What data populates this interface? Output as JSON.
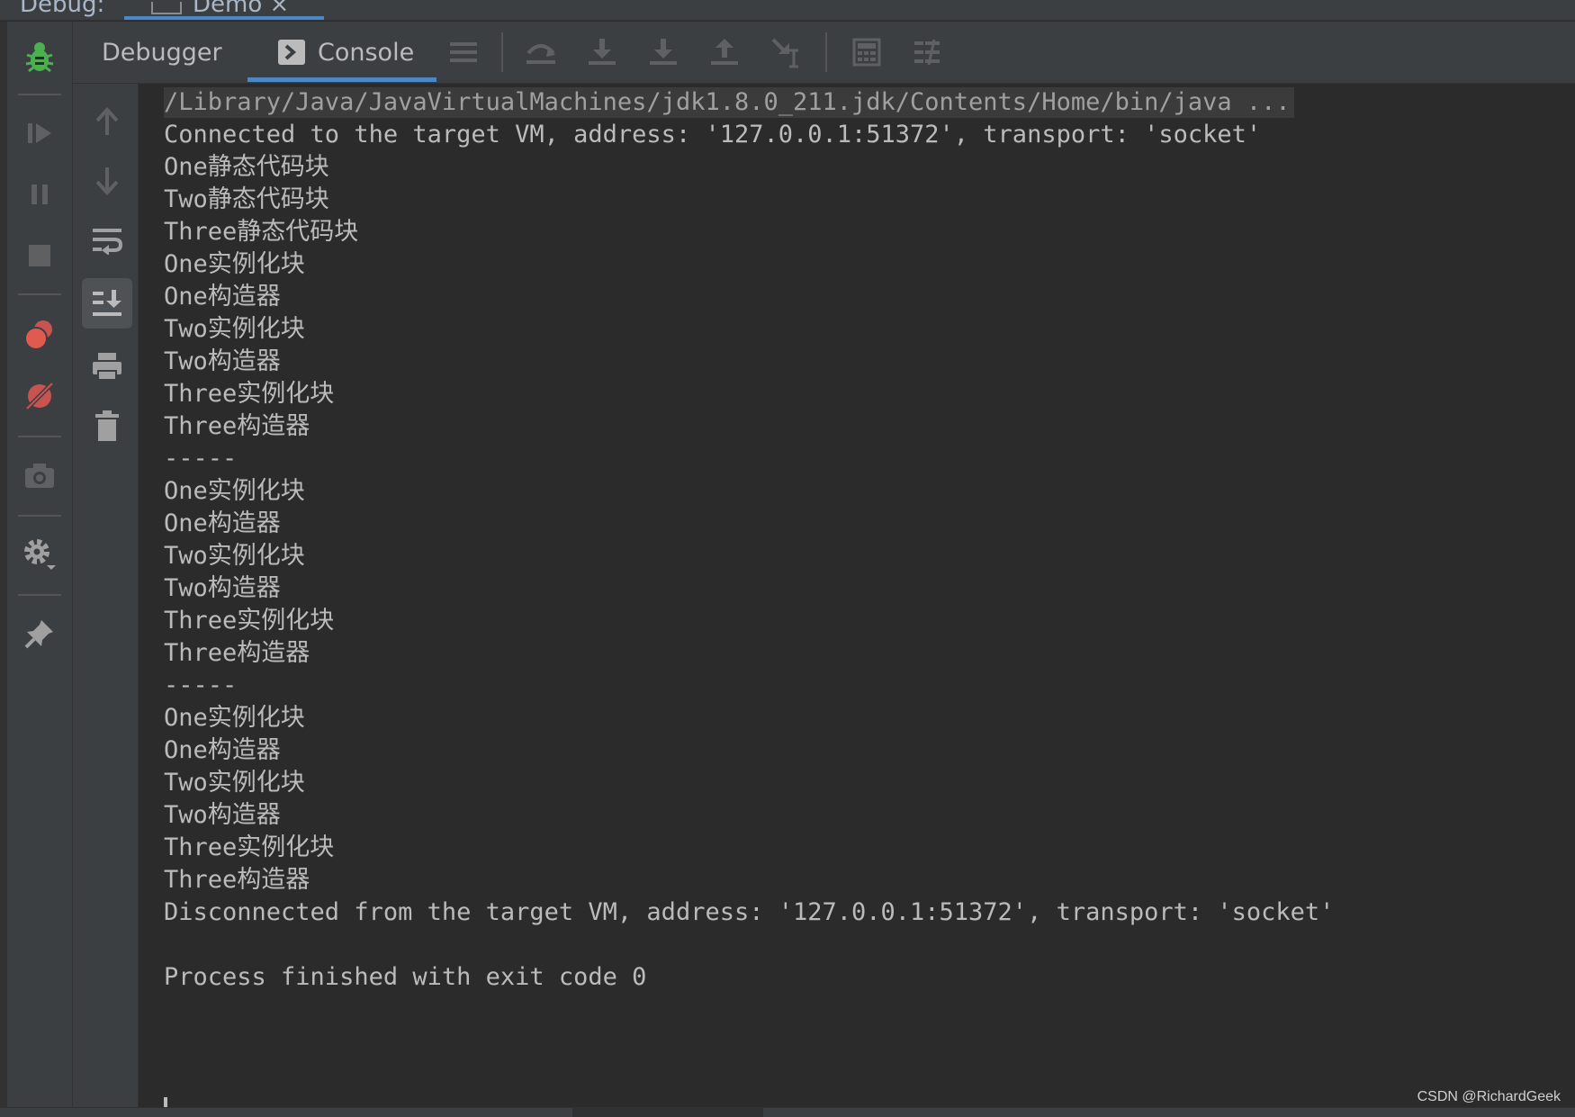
{
  "top_tabs": {
    "debug": "Debug:",
    "demo": "Demo ×"
  },
  "header": {
    "tabs": [
      {
        "label": "Debugger"
      },
      {
        "label": "Console",
        "active": true
      }
    ]
  },
  "console": {
    "lines": [
      "/Library/Java/JavaVirtualMachines/jdk1.8.0_211.jdk/Contents/Home/bin/java ...",
      "Connected to the target VM, address: '127.0.0.1:51372', transport: 'socket'",
      "One静态代码块",
      "Two静态代码块",
      "Three静态代码块",
      "One实例化块",
      "One构造器",
      "Two实例化块",
      "Two构造器",
      "Three实例化块",
      "Three构造器",
      "-----",
      "One实例化块",
      "One构造器",
      "Two实例化块",
      "Two构造器",
      "Three实例化块",
      "Three构造器",
      "-----",
      "One实例化块",
      "One构造器",
      "Two实例化块",
      "Two构造器",
      "Three实例化块",
      "Three构造器",
      "Disconnected from the target VM, address: '127.0.0.1:51372', transport: 'socket'",
      "",
      "Process finished with exit code 0"
    ]
  },
  "watermark": "CSDN @RichardGeek",
  "colors": {
    "background": "#2b2b2b",
    "toolbar": "#3c3f41",
    "text": "#bbbbbb",
    "accent": "#4a88c7",
    "bug_green": "#4caf50",
    "breakpoint_red": "#c75450"
  }
}
